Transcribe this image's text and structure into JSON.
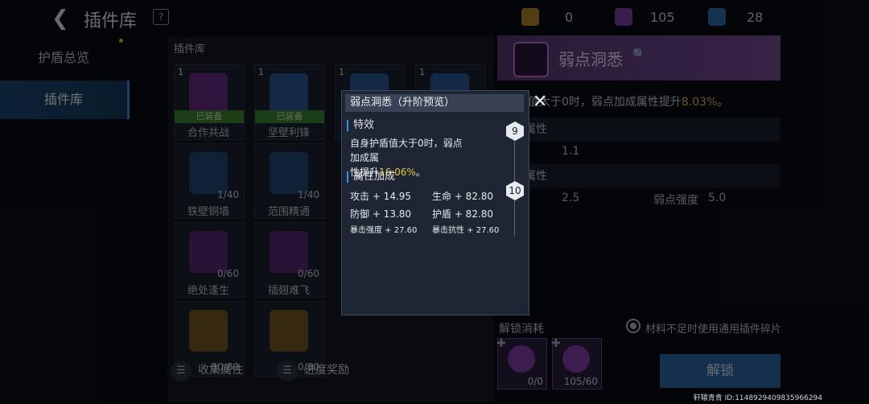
{
  "topbar": {
    "back_glyph": "❮",
    "title": "插件库",
    "help": "?",
    "resources": [
      {
        "icon": "gold-card-icon",
        "value": "0",
        "color": "#b88a2a"
      },
      {
        "icon": "purple-card-icon",
        "value": "105",
        "color": "#7a3ea8"
      },
      {
        "icon": "blue-card-icon",
        "value": "28",
        "color": "#2f6fb5"
      }
    ]
  },
  "nav": {
    "items": [
      "护盾总览",
      "插件库"
    ]
  },
  "grid": {
    "label": "插件库",
    "cards": [
      {
        "name": "合作共战",
        "num": "1",
        "status": "已装备",
        "count": "",
        "color": "#6a2e8a"
      },
      {
        "name": "坚壁利锋",
        "num": "1",
        "status": "已装备",
        "count": "",
        "color": "#2a5c9a"
      },
      {
        "name": "",
        "num": "1",
        "status": "",
        "count": "",
        "color": "#2a5c9a"
      },
      {
        "name": "",
        "num": "1",
        "status": "",
        "count": "",
        "color": "#2a5c9a"
      },
      {
        "name": "铁壁铜墙",
        "num": "",
        "status": "",
        "count": "1/40",
        "color": "#244a78"
      },
      {
        "name": "范围精通",
        "num": "",
        "status": "",
        "count": "1/40",
        "color": "#244a78"
      },
      {
        "name": "绝处逢生",
        "num": "",
        "status": "",
        "count": "0/60",
        "color": "#5a2a78"
      },
      {
        "name": "插翅难飞",
        "num": "",
        "status": "",
        "count": "0/60",
        "color": "#5a2a78"
      },
      {
        "name": "",
        "num": "",
        "status": "",
        "count": "30/80",
        "color": "#7a5a24"
      },
      {
        "name": "",
        "num": "",
        "status": "",
        "count": "0/80",
        "color": "#7a5a24"
      }
    ]
  },
  "bottom": {
    "collect": "收集属性",
    "progress": "进度奖励"
  },
  "detail": {
    "title": "弱点洞悉",
    "search_glyph": "🔍",
    "effect_prefix": "值大于0时，弱点加成属性提升",
    "effect_value": "8.03%",
    "effect_suffix": "。",
    "row1_label": "属性",
    "row1_value": "1.1",
    "row2_label": "属性",
    "row2_value": "2.5",
    "weak_label": "弱点强度",
    "weak_value": "5.0",
    "unlock_label": "解锁消耗",
    "radio_text": "材料不足时使用通用插件碎片",
    "materials": [
      {
        "text": "0/0",
        "color": "#8a3fb0"
      },
      {
        "text": "105/60",
        "color": "#8a3fb0"
      }
    ],
    "unlock_button": "解锁"
  },
  "popup": {
    "title": "弱点洞悉（升阶预览）",
    "effect_header": "特效",
    "effect_line1": "自身护盾值大于0时，弱点加成属",
    "effect_line2_prefix": "性提升",
    "effect_value": "16.06%",
    "effect_line2_suffix": "。",
    "attr_header": "属性加成",
    "attack": "攻击 + 14.95",
    "life": "生命 + 82.80",
    "defense": "防御 + 13.80",
    "shield": "护盾 + 82.80",
    "crit_power": "暴击强度 + 27.60",
    "crit_resist": "暴击抗性 + 27.60",
    "level_from": "9",
    "level_to": "10",
    "close_glyph": "✕"
  },
  "watermark": "轩辕青青 ID:1148929409835966294"
}
